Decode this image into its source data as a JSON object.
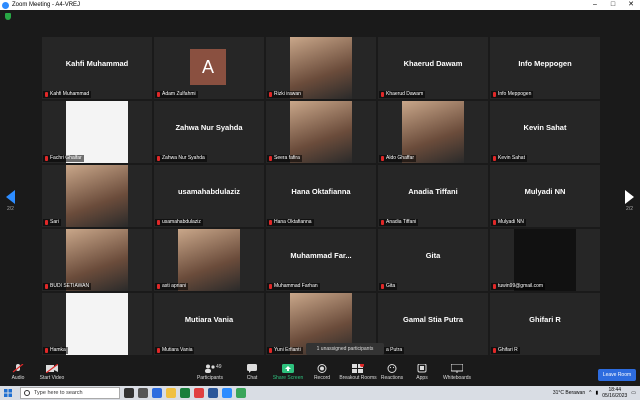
{
  "window": {
    "title": "Zoom Meeting - A4-VREJ"
  },
  "pagination": {
    "left": "2/2",
    "right": "2/2"
  },
  "tiles": [
    {
      "big": "Kahfi Muhammad",
      "label": "Kahfi Muhammad"
    },
    {
      "avatar": "A",
      "label": "Adam Zulfahmi"
    },
    {
      "image": "photo",
      "label": "Rizki irawan"
    },
    {
      "big": "Khaerud Dawam",
      "label": "Khaerud Dawam"
    },
    {
      "big": "Info Meppogen",
      "label": "Info Meppogen"
    },
    {
      "image": "logo",
      "label": "Fachri Ghalfar"
    },
    {
      "big": "Zahwa Nur Syahda",
      "label": "Zahwa Nur Syahda"
    },
    {
      "image": "photo",
      "label": "Seera fafira"
    },
    {
      "image": "photo",
      "label": "Aldo Ghaffar"
    },
    {
      "big": "Kevin Sahat",
      "label": "Kevin Sahat"
    },
    {
      "image": "photo",
      "label": "Sari"
    },
    {
      "big": "usamahabdulaziz",
      "label": "usamahabdulaziz"
    },
    {
      "big": "Hana Oktafianna",
      "label": "Hana Oktafianna"
    },
    {
      "big": "Anadia Tiffani",
      "label": "Anadia Tiffani"
    },
    {
      "big": "Mulyadi NN",
      "label": "Mulyadi NN"
    },
    {
      "image": "photo",
      "label": "BUDI SETIAWAN"
    },
    {
      "image": "photo",
      "label": "asti apriani"
    },
    {
      "big": "Muhammad  Far...",
      "label": "Muhammad Farhan"
    },
    {
      "big": "Gita",
      "label": "Gita"
    },
    {
      "image": "dark",
      "label": "tuwin99@gmail.com"
    },
    {
      "image": "logo",
      "label": "Hamka"
    },
    {
      "big": "Mutiara Vania",
      "label": "Mutiara Vania"
    },
    {
      "image": "photo",
      "label": "Yuni Erfianti"
    },
    {
      "big": "Gamal Stia Putra",
      "label": "a Putra"
    },
    {
      "big": "Ghifari R",
      "label": "Ghifari R"
    }
  ],
  "popup": {
    "text": "1 unassigned participants"
  },
  "toolbar": {
    "audio": "Audio",
    "video": "Start Video",
    "participants": "Participants",
    "participants_count": "49",
    "chat": "Chat",
    "share": "Share Screen",
    "record": "Record",
    "breakout": "Breakout Rooms",
    "reactions": "Reactions",
    "apps": "Apps",
    "whiteboards": "Whiteboards",
    "leave": "Leave Room"
  },
  "taskbar": {
    "search_placeholder": "Type here to search",
    "weather": "31°C  Berawan",
    "time": "18:44",
    "date": "05/16/2023"
  },
  "colors": {
    "accent": "#2d8cff",
    "leave": "#2d6cdf",
    "share": "#2ec27e",
    "mic_muted": "#e02828"
  }
}
